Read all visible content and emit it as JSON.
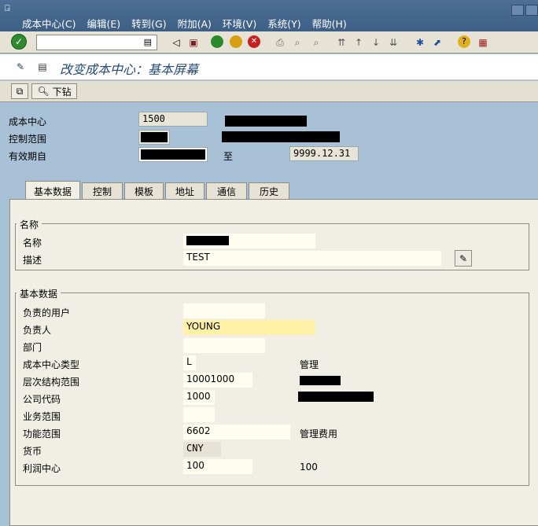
{
  "menu": [
    "成本中心(C)",
    "编辑(E)",
    "转到(G)",
    "附加(A)",
    "环境(V)",
    "系统(Y)",
    "帮助(H)"
  ],
  "toolbar": {
    "command_value": ""
  },
  "title": "改变成本中心：基本屏幕",
  "app_toolbar": {
    "drilldown_label": "下钻"
  },
  "header": {
    "cost_center_label": "成本中心",
    "cost_center_value": "1500",
    "controlling_area_label": "控制范围",
    "valid_from_label": "有效期自",
    "to_label": "至",
    "valid_to_value": "9999.12.31"
  },
  "tabs": [
    "基本数据",
    "控制",
    "模板",
    "地址",
    "通信",
    "历史"
  ],
  "names_group": {
    "title": "名称",
    "name_label": "名称",
    "description_label": "描述",
    "description_value": "TEST"
  },
  "basic_group": {
    "title": "基本数据",
    "rows": [
      {
        "label": "负责的用户",
        "value": "",
        "extra": ""
      },
      {
        "label": "负责人",
        "value": "YOUNG",
        "extra": ""
      },
      {
        "label": "部门",
        "value": "",
        "extra": ""
      },
      {
        "label": "成本中心类型",
        "value": "L",
        "extra": "管理"
      },
      {
        "label": "层次结构范围",
        "value": "10001000",
        "extra": ""
      },
      {
        "label": "公司代码",
        "value": "1000",
        "extra": ""
      },
      {
        "label": "业务范围",
        "value": "",
        "extra": ""
      },
      {
        "label": "功能范围",
        "value": "6602",
        "extra": "管理费用"
      },
      {
        "label": "货币",
        "value": "CNY",
        "extra": ""
      },
      {
        "label": "利润中心",
        "value": "100",
        "extra": "100"
      }
    ]
  }
}
